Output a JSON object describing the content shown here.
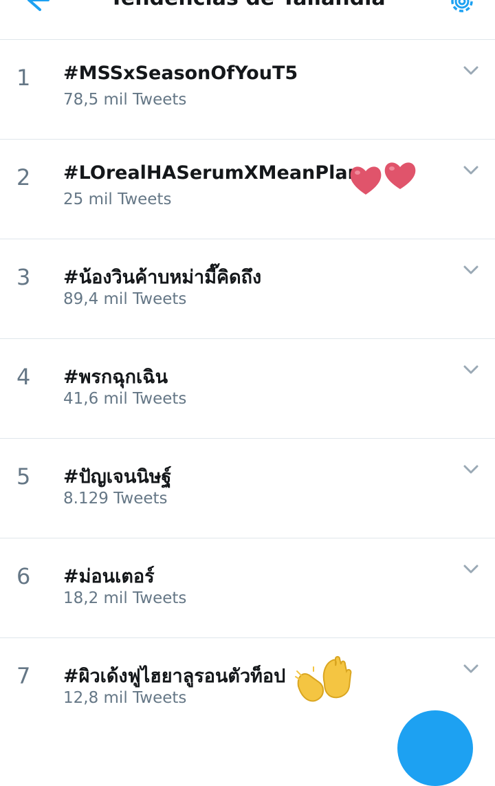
{
  "header": {
    "title": "Tendencias de Tailandia"
  },
  "colors": {
    "accent": "#1da1f2",
    "text_primary": "#14171a",
    "text_secondary": "#657786",
    "divider": "#dfe6eb",
    "heart": "#e0546b",
    "clap": "#f4c542"
  },
  "trends": [
    {
      "rank": "1",
      "name": "#MSSxSeasonOfYouT5",
      "count": "78,5 mil Tweets"
    },
    {
      "rank": "2",
      "name": "#LOrealHASerumXMeanPlan",
      "count": "25 mil Tweets"
    },
    {
      "rank": "3",
      "name": "#น้องวินค้าบหม่ามี๊คิดถึง",
      "count": "89,4 mil Tweets"
    },
    {
      "rank": "4",
      "name": "#พรกฉุกเฉิน",
      "count": "41,6 mil Tweets"
    },
    {
      "rank": "5",
      "name": "#ปัญเจนนิษฐ์",
      "count": "8.129 Tweets"
    },
    {
      "rank": "6",
      "name": "#ม่อนเตอร์",
      "count": "18,2 mil Tweets"
    },
    {
      "rank": "7",
      "name": "#ผิวเด้งฟูไฮยาลูรอนตัวท็อป",
      "count": "12,8 mil Tweets"
    }
  ],
  "icons": {
    "back": "arrow-left-icon",
    "settings": "gear-icon",
    "more": "chevron-down-icon",
    "hearts": "two-hearts-emoji",
    "clap": "raising-hands-emoji",
    "compose": "compose-fab"
  }
}
